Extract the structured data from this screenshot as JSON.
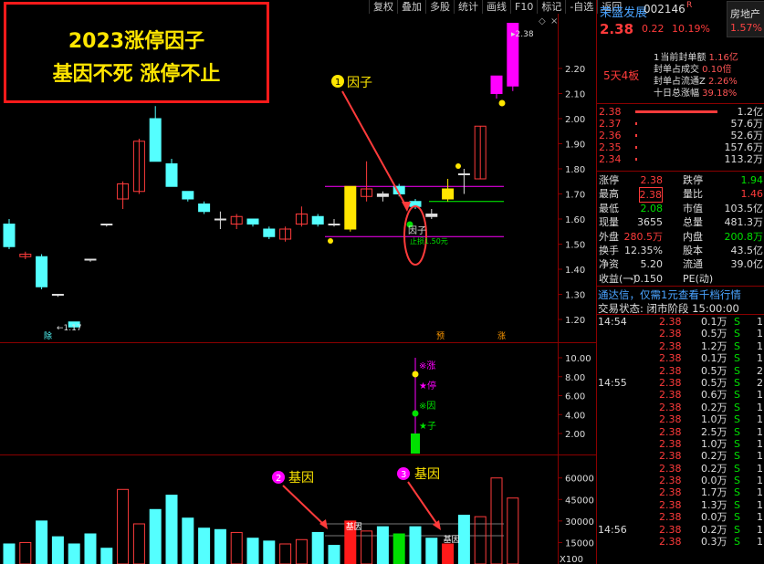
{
  "headline": {
    "line1": "2023涨停因子",
    "line2": "基因不死 涨停不止"
  },
  "toolbar": [
    "复权",
    "叠加",
    "多股",
    "统计",
    "画线",
    "F10",
    "标记",
    "-自选",
    "返回"
  ],
  "stock": {
    "name": "荣盛发展",
    "code": "002146",
    "badge": "R",
    "price": "2.38",
    "change": "0.22",
    "change_pct": "10.19%",
    "sector": "房地产",
    "sector_pct": "1.57%",
    "board": "5天4板"
  },
  "seal": {
    "rows": [
      {
        "label": "当前封单额",
        "value": "1.16亿",
        "marker": "1"
      },
      {
        "label": "封单占成交",
        "value": "0.10倍",
        "marker": ""
      },
      {
        "label": "封单占流通Z",
        "value": "2.26%",
        "marker": ""
      },
      {
        "label": "十日总涨幅",
        "value": "39.18%",
        "marker": ""
      }
    ]
  },
  "order_book": [
    {
      "price": "2.38",
      "vol": "1.2亿",
      "bar": 1.0
    },
    {
      "price": "2.37",
      "vol": "57.6万",
      "bar": 0.02
    },
    {
      "price": "2.36",
      "vol": "52.6万",
      "bar": 0.02
    },
    {
      "price": "2.35",
      "vol": "157.6万",
      "bar": 0.02
    },
    {
      "price": "2.34",
      "vol": "113.2万",
      "bar": 0.02
    }
  ],
  "quote": [
    {
      "l1": "涨停",
      "v1": "2.38",
      "c1": "red",
      "l2": "跌停",
      "v2": "1.94",
      "c2": "green"
    },
    {
      "l1": "最高",
      "v1": "2.38",
      "c1": "red",
      "l2": "量比",
      "v2": "1.46",
      "c2": "red",
      "box1": true
    },
    {
      "l1": "最低",
      "v1": "2.08",
      "c1": "green",
      "l2": "市值",
      "v2": "103.5亿",
      "c2": "white"
    },
    {
      "l1": "现量",
      "v1": "3655",
      "c1": "white",
      "l2": "总量",
      "v2": "481.3万",
      "c2": "white"
    },
    {
      "l1": "外盘",
      "v1": "280.5万",
      "c1": "red",
      "l2": "内盘",
      "v2": "200.8万",
      "c2": "green"
    },
    {
      "l1": "换手",
      "v1": "12.35%",
      "c1": "white",
      "l2": "股本",
      "v2": "43.5亿",
      "c2": "white"
    },
    {
      "l1": "净资",
      "v1": "5.20",
      "c1": "white",
      "l2": "流通",
      "v2": "39.0亿",
      "c2": "white"
    },
    {
      "l1": "收益(一)",
      "v1": "-0.150",
      "c1": "white",
      "l2": "PE(动)",
      "v2": "",
      "c2": "white"
    }
  ],
  "tdx_ad": "通达信，仅需1元查看千档行情",
  "trade_state": {
    "label": "交易状态:",
    "value": "闭市阶段 15:00:00"
  },
  "trades": [
    {
      "time": "14:54",
      "price": "2.38",
      "vol": "0.1万",
      "side": "S",
      "n": "1"
    },
    {
      "time": "",
      "price": "2.38",
      "vol": "0.5万",
      "side": "S",
      "n": "1"
    },
    {
      "time": "",
      "price": "2.38",
      "vol": "1.2万",
      "side": "S",
      "n": "1"
    },
    {
      "time": "",
      "price": "2.38",
      "vol": "0.1万",
      "side": "S",
      "n": "1"
    },
    {
      "time": "",
      "price": "2.38",
      "vol": "0.5万",
      "side": "S",
      "n": "2"
    },
    {
      "time": "14:55",
      "price": "2.38",
      "vol": "0.5万",
      "side": "S",
      "n": "2"
    },
    {
      "time": "",
      "price": "2.38",
      "vol": "0.6万",
      "side": "S",
      "n": "1"
    },
    {
      "time": "",
      "price": "2.38",
      "vol": "0.2万",
      "side": "S",
      "n": "1"
    },
    {
      "time": "",
      "price": "2.38",
      "vol": "1.0万",
      "side": "S",
      "n": "1"
    },
    {
      "time": "",
      "price": "2.38",
      "vol": "2.5万",
      "side": "S",
      "n": "1"
    },
    {
      "time": "",
      "price": "2.38",
      "vol": "1.0万",
      "side": "S",
      "n": "1"
    },
    {
      "time": "",
      "price": "2.38",
      "vol": "0.2万",
      "side": "S",
      "n": "1"
    },
    {
      "time": "",
      "price": "2.38",
      "vol": "0.2万",
      "side": "S",
      "n": "1"
    },
    {
      "time": "",
      "price": "2.38",
      "vol": "0.0万",
      "side": "S",
      "n": "1"
    },
    {
      "time": "",
      "price": "2.38",
      "vol": "1.7万",
      "side": "S",
      "n": "1"
    },
    {
      "time": "",
      "price": "2.38",
      "vol": "1.3万",
      "side": "S",
      "n": "1"
    },
    {
      "time": "",
      "price": "2.38",
      "vol": "0.0万",
      "side": "S",
      "n": "1"
    },
    {
      "time": "14:56",
      "price": "2.38",
      "vol": "0.2万",
      "side": "S",
      "n": "1"
    },
    {
      "time": "",
      "price": "2.38",
      "vol": "0.3万",
      "side": "S",
      "n": "1"
    }
  ],
  "main_axis": [
    "2.20",
    "2.10",
    "2.00",
    "1.90",
    "1.80",
    "1.70",
    "1.60",
    "1.50",
    "1.40",
    "1.30",
    "1.20"
  ],
  "ind_axis": [
    "10.00",
    "8.00",
    "6.00",
    "4.00",
    "2.00"
  ],
  "vol_axis": [
    "60000",
    "45000",
    "30000",
    "15000"
  ],
  "vol_unit": "X100",
  "annotations": {
    "factor_circle": "1",
    "factor_label": "因子",
    "gene_circle_2": "2",
    "gene_label_2": "基因",
    "gene_circle_3": "3",
    "gene_label_3": "基因",
    "marker_price": "2.38",
    "low_price": "1.17",
    "stop_label": "止损1.50元",
    "factor_tag": "因子",
    "mark_ex": "除",
    "mark_a": "预",
    "mark_b": "涨",
    "ind_labels": [
      "※涨",
      "★停",
      "※因",
      "★子"
    ],
    "vol_tag": "基因"
  },
  "colors": {
    "up_red": "#ff3b3b",
    "down_cyan": "#54ffff",
    "yellow": "#ffe600",
    "magenta": "#ff00ff",
    "green": "#00ff00"
  },
  "chart_data": {
    "type": "candlestick",
    "price_ylim": [
      1.12,
      2.4
    ],
    "candles": [
      {
        "o": 1.58,
        "h": 1.6,
        "l": 1.48,
        "c": 1.49,
        "dir": "down"
      },
      {
        "o": 1.45,
        "h": 1.47,
        "l": 1.44,
        "c": 1.46,
        "dir": "up"
      },
      {
        "o": 1.45,
        "h": 1.46,
        "l": 1.32,
        "c": 1.33,
        "dir": "down"
      },
      {
        "o": 1.3,
        "h": 1.3,
        "l": 1.29,
        "c": 1.3,
        "dir": "flat"
      },
      {
        "o": 1.19,
        "h": 1.19,
        "l": 1.16,
        "c": 1.17,
        "dir": "down"
      },
      {
        "o": 1.44,
        "h": 1.44,
        "l": 1.43,
        "c": 1.44,
        "dir": "flat"
      },
      {
        "o": 1.58,
        "h": 1.58,
        "l": 1.57,
        "c": 1.58,
        "dir": "flat"
      },
      {
        "o": 1.68,
        "h": 1.75,
        "l": 1.64,
        "c": 1.74,
        "dir": "up"
      },
      {
        "o": 1.71,
        "h": 1.92,
        "l": 1.7,
        "c": 1.91,
        "dir": "up"
      },
      {
        "o": 2.0,
        "h": 2.05,
        "l": 1.83,
        "c": 1.83,
        "dir": "down"
      },
      {
        "o": 1.82,
        "h": 1.84,
        "l": 1.73,
        "c": 1.73,
        "dir": "down"
      },
      {
        "o": 1.71,
        "h": 1.71,
        "l": 1.67,
        "c": 1.68,
        "dir": "down"
      },
      {
        "o": 1.66,
        "h": 1.67,
        "l": 1.62,
        "c": 1.63,
        "dir": "down"
      },
      {
        "o": 1.6,
        "h": 1.63,
        "l": 1.56,
        "c": 1.6,
        "dir": "flat"
      },
      {
        "o": 1.58,
        "h": 1.62,
        "l": 1.56,
        "c": 1.61,
        "dir": "up"
      },
      {
        "o": 1.6,
        "h": 1.6,
        "l": 1.57,
        "c": 1.58,
        "dir": "down"
      },
      {
        "o": 1.56,
        "h": 1.57,
        "l": 1.52,
        "c": 1.53,
        "dir": "down"
      },
      {
        "o": 1.52,
        "h": 1.57,
        "l": 1.51,
        "c": 1.56,
        "dir": "up"
      },
      {
        "o": 1.58,
        "h": 1.65,
        "l": 1.57,
        "c": 1.62,
        "dir": "up"
      },
      {
        "o": 1.61,
        "h": 1.62,
        "l": 1.57,
        "c": 1.58,
        "dir": "down"
      },
      {
        "o": 1.58,
        "h": 1.6,
        "l": 1.57,
        "c": 1.58,
        "dir": "flat"
      },
      {
        "o": 1.56,
        "h": 1.73,
        "l": 1.55,
        "c": 1.73,
        "dir": "limit"
      },
      {
        "o": 1.69,
        "h": 1.83,
        "l": 1.67,
        "c": 1.72,
        "dir": "up"
      },
      {
        "o": 1.7,
        "h": 1.71,
        "l": 1.67,
        "c": 1.69,
        "dir": "flat"
      },
      {
        "o": 1.73,
        "h": 1.74,
        "l": 1.69,
        "c": 1.7,
        "dir": "down"
      },
      {
        "o": 1.67,
        "h": 1.68,
        "l": 1.64,
        "c": 1.65,
        "dir": "down"
      },
      {
        "o": 1.61,
        "h": 1.64,
        "l": 1.6,
        "c": 1.62,
        "dir": "flat"
      },
      {
        "o": 1.72,
        "h": 1.76,
        "l": 1.67,
        "c": 1.68,
        "dir": "limit"
      },
      {
        "o": 1.78,
        "h": 1.8,
        "l": 1.7,
        "c": 1.78,
        "dir": "flat"
      },
      {
        "o": 1.76,
        "h": 1.97,
        "l": 1.76,
        "c": 1.97,
        "dir": "up"
      },
      {
        "o": 2.1,
        "h": 2.17,
        "l": 2.08,
        "c": 2.17,
        "dir": "mag"
      },
      {
        "o": 2.13,
        "h": 2.38,
        "l": 2.11,
        "c": 2.38,
        "dir": "mag"
      }
    ],
    "volume": [
      14000,
      15000,
      30000,
      19000,
      14000,
      21000,
      11000,
      52000,
      28000,
      38000,
      48000,
      32000,
      25000,
      24000,
      22000,
      18000,
      16000,
      14000,
      17000,
      22000,
      13000,
      30000,
      23000,
      26000,
      21000,
      26000,
      18000,
      14000,
      34000,
      33000,
      60000,
      46000
    ]
  }
}
